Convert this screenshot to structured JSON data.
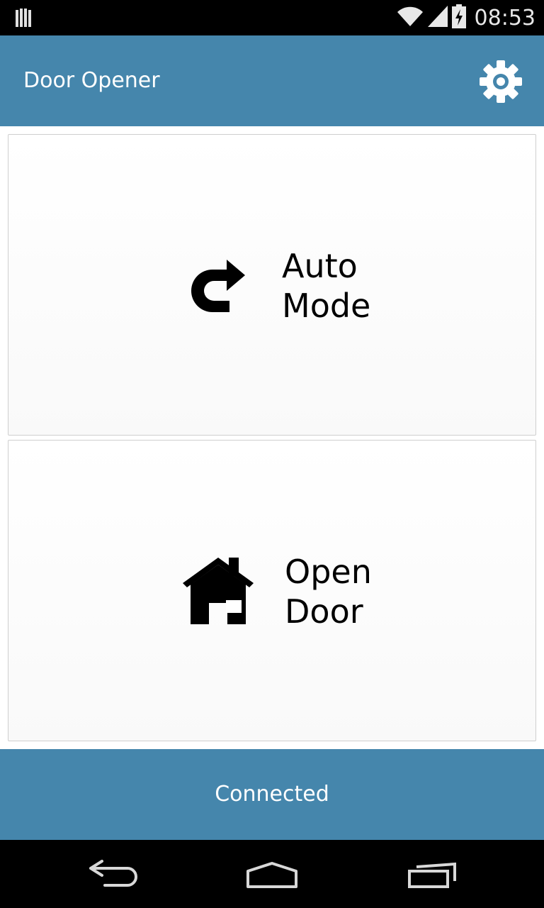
{
  "status_bar": {
    "time": "08:53",
    "icons": [
      "notification-icon",
      "wifi-icon",
      "signal-icon",
      "battery-charging-icon"
    ]
  },
  "action_bar": {
    "title": "Door Opener",
    "settings_icon": "gear-icon"
  },
  "buttons": [
    {
      "name": "auto-mode",
      "icon": "redo-arrow-icon",
      "line1": "Auto",
      "line2": "Mode"
    },
    {
      "name": "open-door",
      "icon": "house-icon",
      "line1": "Open",
      "line2": "Door"
    }
  ],
  "connection_status": "Connected",
  "nav_bar": {
    "icons": [
      "back-icon",
      "home-icon",
      "recents-icon"
    ]
  },
  "colors": {
    "accent": "#4586ac",
    "system_bar": "#000000"
  }
}
